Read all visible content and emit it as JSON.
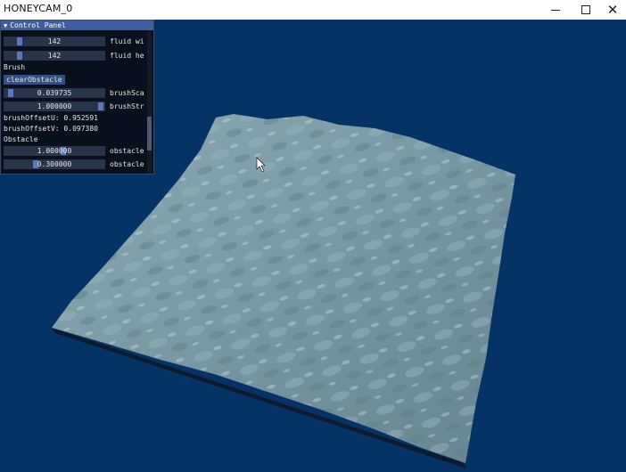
{
  "window": {
    "title": "HONEYCAM",
    "title_suffix": "_0",
    "controls": {
      "minimize": "minimize",
      "maximize": "maximize",
      "close": "✕"
    }
  },
  "control_panel": {
    "title": "Control Panel",
    "collapse_icon": "▼",
    "sliders_top": [
      {
        "value": "142",
        "label": "fluid wi",
        "fraction": 0.13
      },
      {
        "value": "142",
        "label": "fluid he",
        "fraction": 0.13
      }
    ],
    "brush": {
      "section_label": "Brush",
      "clear_button": "clearObstacle",
      "sliders": [
        {
          "value": "0.039735",
          "label": "brushSca",
          "fraction": 0.04
        },
        {
          "value": "1.000000",
          "label": "brushStr",
          "fraction": 1.0
        }
      ],
      "offset_u": "brushOffsetU: 0.952591",
      "offset_v": "brushOffsetV: 0.097380"
    },
    "obstacle": {
      "section_label": "Obstacle",
      "sliders": [
        {
          "value": "1.000000",
          "label": "obstacle",
          "fraction": 0.58
        },
        {
          "value": "0.300000",
          "label": "obstacle",
          "fraction": 0.3
        }
      ]
    }
  },
  "scene": {
    "background_color": "#063366",
    "surface_color": "#7a9aa5",
    "shadow_color": "#0c1a2e"
  }
}
